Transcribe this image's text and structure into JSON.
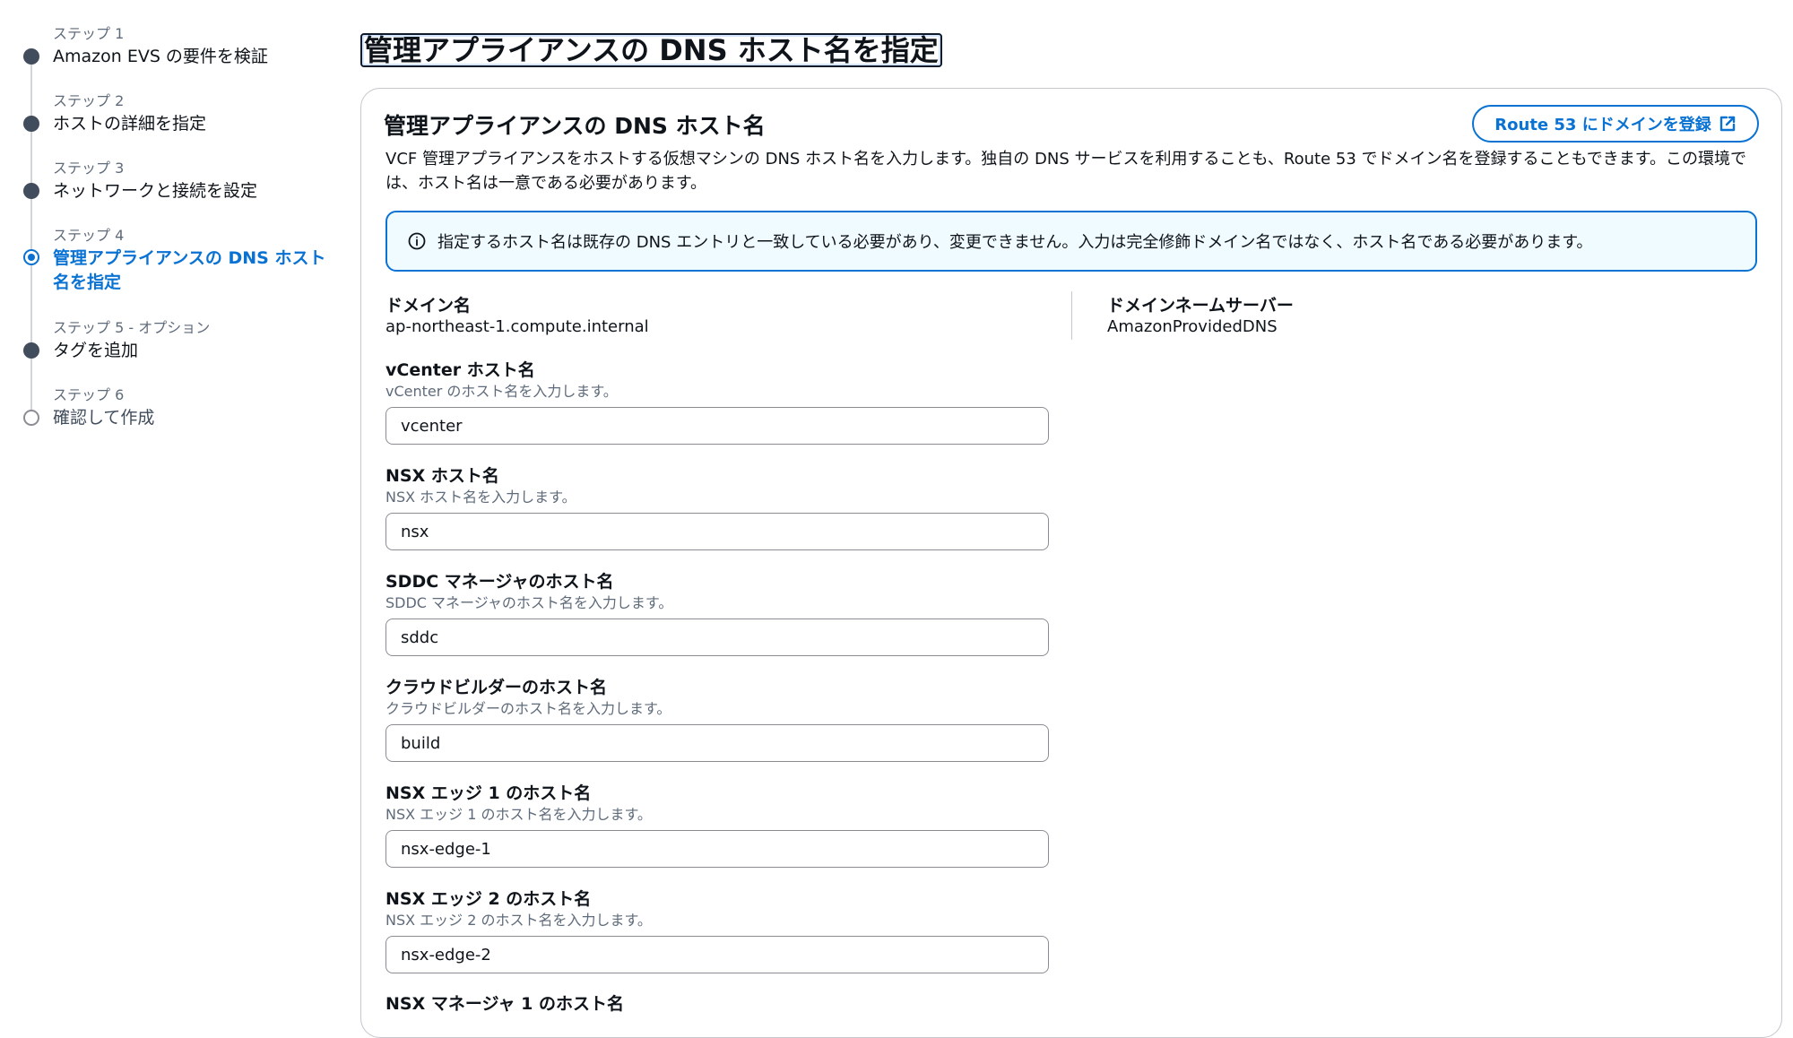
{
  "steps": [
    {
      "kicker": "ステップ 1",
      "title": "Amazon EVS の要件を検証",
      "state": "complete"
    },
    {
      "kicker": "ステップ 2",
      "title": "ホストの詳細を指定",
      "state": "complete"
    },
    {
      "kicker": "ステップ 3",
      "title": "ネットワークと接続を設定",
      "state": "complete"
    },
    {
      "kicker": "ステップ 4",
      "title": "管理アプライアンスの DNS ホスト名を指定",
      "state": "active"
    },
    {
      "kicker": "ステップ 5 - オプション",
      "title": "タグを追加",
      "state": "complete"
    },
    {
      "kicker": "ステップ 6",
      "title": "確認して作成",
      "state": "upcoming"
    }
  ],
  "page_title": "管理アプライアンスの DNS ホスト名を指定",
  "card": {
    "title": "管理アプライアンスの DNS ホスト名",
    "register_button": "Route 53 にドメインを登録",
    "description": "VCF 管理アプライアンスをホストする仮想マシンの DNS ホスト名を入力します。独自の DNS サービスを利用することも、Route 53 でドメイン名を登録することもできます。この環境では、ホスト名は一意である必要があります。",
    "alert": "指定するホスト名は既存の DNS エントリと一致している必要があり、変更できません。入力は完全修飾ドメイン名ではなく、ホスト名である必要があります。"
  },
  "domain": {
    "label": "ドメイン名",
    "value": "ap-northeast-1.compute.internal"
  },
  "nameserver": {
    "label": "ドメインネームサーバー",
    "value": "AmazonProvidedDNS"
  },
  "fields": [
    {
      "label": "vCenter ホスト名",
      "hint": "vCenter のホスト名を入力します。",
      "value": "vcenter"
    },
    {
      "label": "NSX ホスト名",
      "hint": "NSX ホスト名を入力します。",
      "value": "nsx"
    },
    {
      "label": "SDDC マネージャのホスト名",
      "hint": "SDDC マネージャのホスト名を入力します。",
      "value": "sddc"
    },
    {
      "label": "クラウドビルダーのホスト名",
      "hint": "クラウドビルダーのホスト名を入力します。",
      "value": "build"
    },
    {
      "label": "NSX エッジ 1 のホスト名",
      "hint": "NSX エッジ 1 のホスト名を入力します。",
      "value": "nsx-edge-1"
    },
    {
      "label": "NSX エッジ 2 のホスト名",
      "hint": "NSX エッジ 2 のホスト名を入力します。",
      "value": "nsx-edge-2"
    },
    {
      "label": "NSX マネージャ 1 のホスト名"
    }
  ],
  "colors": {
    "accent": "#0972d3",
    "step_complete": "#414d5c",
    "alert_background": "#f0fbff"
  }
}
